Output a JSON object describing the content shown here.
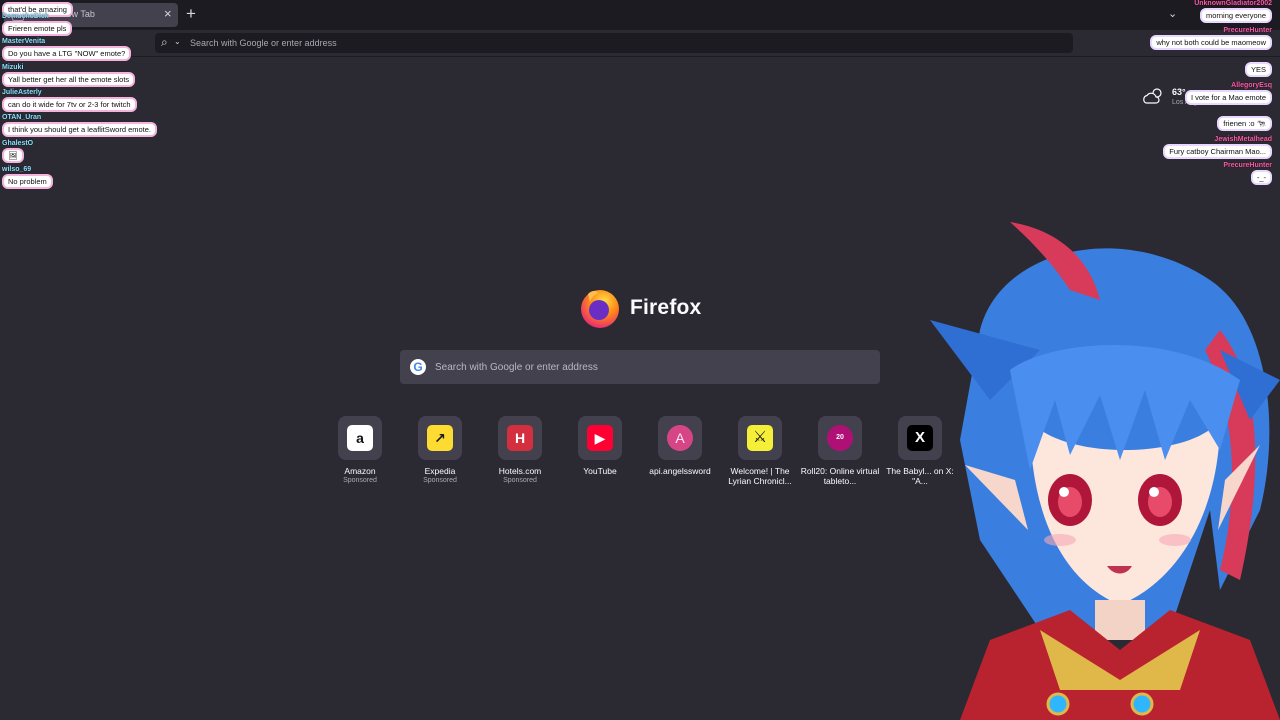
{
  "browser": {
    "tab_title": "New Tab",
    "tab_close_glyph": "×",
    "new_tab_glyph": "+",
    "tab_list_glyph": "⌄",
    "url_placeholder": "Search with Google or enter address",
    "search_glyph": "⌕",
    "chevron_glyph": "⌄"
  },
  "newtab": {
    "wordmark": "Firefox",
    "search_placeholder": "Search with Google or enter address",
    "google_glyph": "G",
    "edit_glyph": "✎",
    "weather": {
      "temp": "63°",
      "location": "Los Angeles",
      "icon": "cloud-sun-icon"
    },
    "shortcuts": [
      {
        "label": "Amazon",
        "sponsored": "Sponsored",
        "glyph": "a",
        "bg": "#ffffff",
        "fg": "#111111"
      },
      {
        "label": "Expedia",
        "sponsored": "Sponsored",
        "glyph": "↗",
        "bg": "#fddb32",
        "fg": "#1a1a1a"
      },
      {
        "label": "Hotels.com",
        "sponsored": "Sponsored",
        "glyph": "H",
        "bg": "#d32f3f",
        "fg": "#ffffff"
      },
      {
        "label": "YouTube",
        "sponsored": "",
        "glyph": "▶",
        "bg": "#ff0033",
        "fg": "#ffffff"
      },
      {
        "label": "api.angelssword",
        "sponsored": "",
        "glyph": "A",
        "bg": "#d64586",
        "fg": "#fde7f1"
      },
      {
        "label": "Welcome! | The Lyrian Chronicl...",
        "sponsored": "",
        "glyph": "⚔",
        "bg": "#f6ef3a",
        "fg": "#1a1a1a"
      },
      {
        "label": "Roll20: Online virtual tableto...",
        "sponsored": "",
        "glyph": "20",
        "bg": "#b01075",
        "fg": "#ffffff"
      },
      {
        "label": "The Babyl... on X: \"A...",
        "sponsored": "",
        "glyph": "X",
        "bg": "#000000",
        "fg": "#ffffff"
      }
    ]
  },
  "chat_left": [
    {
      "user": "",
      "text": "that'd be amazing"
    },
    {
      "user": "DemuchoDick",
      "text": "Frieren emote pls"
    },
    {
      "user": "MasterVenita",
      "text": "Do you have a LTG \"NOW\" emote?"
    },
    {
      "user": "Mizuki",
      "text": "Yall better get her all the emote slots"
    },
    {
      "user": "JulieAsterly",
      "text": "can do it wide for 7tv or 2-3 for twitch"
    },
    {
      "user": "OTAN_Uran",
      "text": "I think you should get a leaflitSword emote."
    },
    {
      "user": "GhalestO",
      "text": "🖼"
    },
    {
      "user": "wilso_69",
      "text": "No problem"
    }
  ],
  "chat_right": [
    {
      "user": "UnknownGladiator2002",
      "text": "morning everyone"
    },
    {
      "user": "PrecureHunter",
      "text": "why not both could be maomeow"
    },
    {
      "user": "",
      "text": "YES"
    },
    {
      "user": "AllegoryEsq",
      "text": "I vote for a Mao emote"
    },
    {
      "user": "",
      "text": "frienen :o 🐄"
    },
    {
      "user": "JewishMetalhead",
      "text": "Fury catboy Chairman Mao..."
    },
    {
      "user": "PrecureHunter",
      "text": "-_-"
    }
  ]
}
